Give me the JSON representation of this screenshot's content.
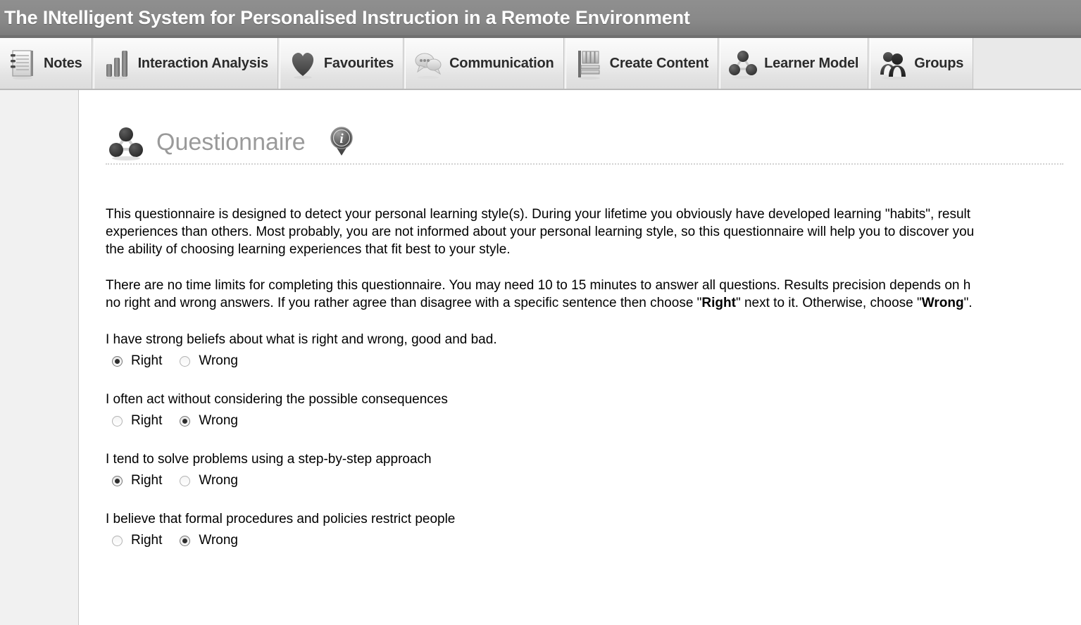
{
  "header": {
    "title": "The INtelligent System for Personalised Instruction in a Remote Environment",
    "background_color": "#8a8a8a",
    "text_color": "#ffffff"
  },
  "tabs": [
    {
      "label": "Notes",
      "icon": "notes-icon"
    },
    {
      "label": "Interaction Analysis",
      "icon": "bar-chart-icon"
    },
    {
      "label": "Favourites",
      "icon": "heart-icon"
    },
    {
      "label": "Communication",
      "icon": "speech-bubble-icon"
    },
    {
      "label": "Create Content",
      "icon": "books-shelf-icon"
    },
    {
      "label": "Learner Model",
      "icon": "node-graph-icon"
    },
    {
      "label": "Groups",
      "icon": "people-icon"
    }
  ],
  "page": {
    "title": "Questionnaire",
    "title_icon": "node-graph-icon",
    "info_icon": "info-badge-icon",
    "title_color": "#9a9a9a"
  },
  "intro": {
    "paragraph_1": "This questionnaire is designed to detect your personal learning style(s). During your lifetime you obviously have developed learning \"habits\", result\nexperiences than others. Most probably, you are not informed about your personal learning style, so this questionnaire will help you to discover you\nthe ability of choosing learning experiences that fit best to your style.",
    "paragraph_2_part_1": "There are no time limits for completing this questionnaire. You may need 10 to 15 minutes to answer all questions. Results precision depends on h\nno right and wrong answers. If you rather agree than disagree with a specific sentence then choose \"",
    "paragraph_2_bold_1": "Right",
    "paragraph_2_part_2": "\" next to it. Otherwise, choose \"",
    "paragraph_2_bold_2": "Wrong",
    "paragraph_2_part_3": "\"."
  },
  "options": {
    "right_label": "Right",
    "wrong_label": "Wrong"
  },
  "questions": [
    {
      "text": "I have strong beliefs about what is right and wrong, good and bad.",
      "answer": "Right"
    },
    {
      "text": "I often act without considering the possible consequences",
      "answer": "Wrong"
    },
    {
      "text": "I tend to solve problems using a step-by-step approach",
      "answer": "Right"
    },
    {
      "text": "I believe that formal procedures and policies restrict people",
      "answer": "Wrong"
    }
  ]
}
